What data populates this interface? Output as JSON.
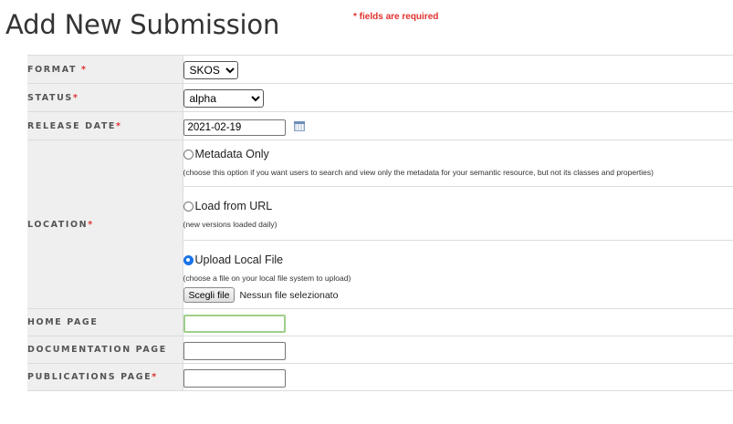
{
  "page": {
    "title": "Add New Submission",
    "required_note": "* fields are required"
  },
  "form": {
    "format": {
      "label": "FORMAT",
      "required_mark": "*",
      "selected": "SKOS"
    },
    "status": {
      "label": "STATUS",
      "required_mark": "*",
      "selected": "alpha"
    },
    "release_date": {
      "label": "RELEASE DATE",
      "required_mark": "*",
      "value": "2021-02-19"
    },
    "location": {
      "label": "LOCATION",
      "required_mark": "*",
      "options": [
        {
          "label": "Metadata Only",
          "hint": "(choose this option if you want users to search and view only the metadata for your semantic resource, but not its classes and properties)",
          "checked": false
        },
        {
          "label": "Load from URL",
          "hint": "(new versions loaded daily)",
          "checked": false
        },
        {
          "label": "Upload Local File",
          "hint": "(choose a file on your local file system to upload)",
          "checked": true
        }
      ],
      "file_button": "Scegli file",
      "file_status": "Nessun file selezionato"
    },
    "home_page": {
      "label": "HOME PAGE",
      "value": ""
    },
    "documentation_page": {
      "label": "DOCUMENTATION PAGE",
      "value": ""
    },
    "publications_page": {
      "label": "PUBLICATIONS PAGE",
      "required_mark": "*",
      "value": ""
    }
  },
  "colors": {
    "required": "#e0312e",
    "label_bg": "#efefef",
    "radio_selected": "#1a73e8",
    "focus_border": "#9fcf8a"
  }
}
